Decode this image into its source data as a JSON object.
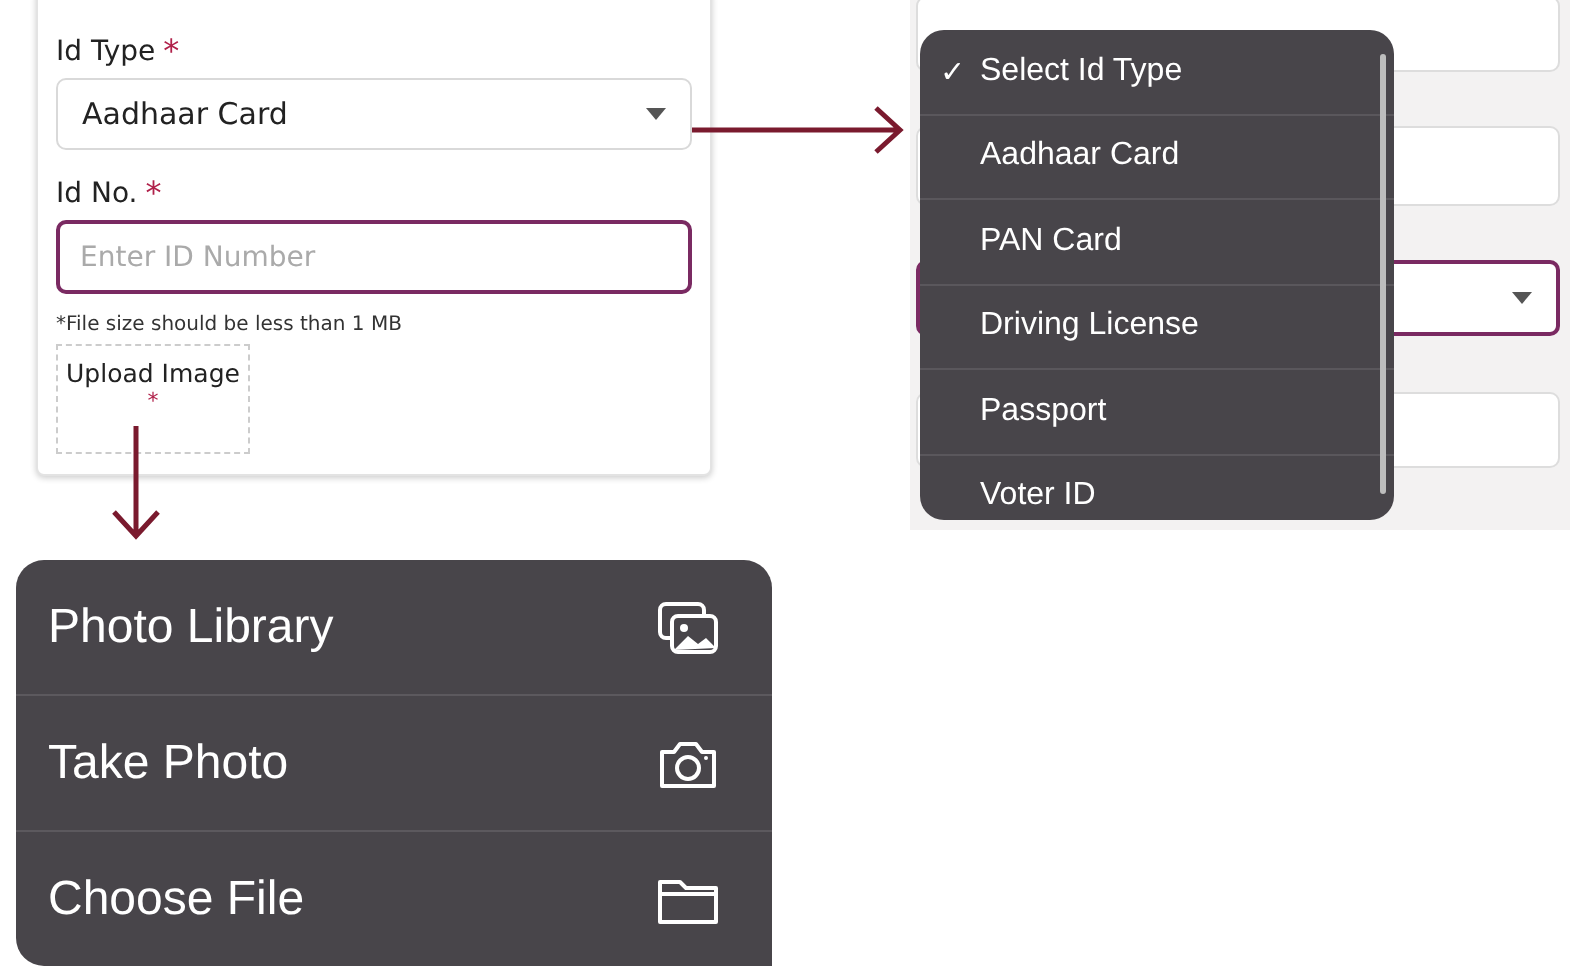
{
  "form": {
    "id_type": {
      "label": "Id Type",
      "required_mark": "*",
      "value": "Aadhaar Card"
    },
    "id_no": {
      "label": "Id No.",
      "required_mark": "*",
      "placeholder": "Enter ID Number"
    },
    "note": "*File size should be less than 1 MB",
    "upload": {
      "label": "Upload Image",
      "required_mark": "*"
    }
  },
  "dropdown": {
    "check": "✓",
    "options": [
      {
        "label": "Select Id Type",
        "selected": true
      },
      {
        "label": "Aadhaar Card",
        "selected": false
      },
      {
        "label": "PAN Card",
        "selected": false
      },
      {
        "label": "Driving License",
        "selected": false
      },
      {
        "label": "Passport",
        "selected": false
      },
      {
        "label": "Voter ID",
        "selected": false
      }
    ]
  },
  "action_sheet": {
    "items": [
      {
        "label": "Photo Library",
        "kind": "photos"
      },
      {
        "label": "Take Photo",
        "kind": "camera"
      },
      {
        "label": "Choose File",
        "kind": "folder"
      }
    ]
  }
}
